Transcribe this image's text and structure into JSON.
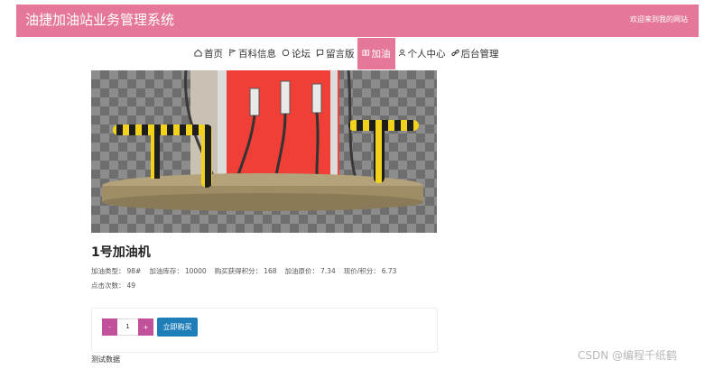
{
  "header": {
    "site_title": "油捷加油站业务管理系统",
    "welcome_text": "欢迎来到我的网站",
    "bg_color": "#e57898"
  },
  "nav": {
    "items": [
      {
        "label": "首页",
        "icon": "home-icon",
        "active": false
      },
      {
        "label": "百科信息",
        "icon": "flag-icon",
        "active": false
      },
      {
        "label": "论坛",
        "icon": "chat-circle-icon",
        "active": false
      },
      {
        "label": "留言版",
        "icon": "comment-icon",
        "active": false
      },
      {
        "label": "加油",
        "icon": "fuel-icon",
        "active": true
      },
      {
        "label": "个人中心",
        "icon": "user-icon",
        "active": false
      },
      {
        "label": "后台管理",
        "icon": "link-icon",
        "active": false
      }
    ]
  },
  "product": {
    "title": "1号加油机",
    "image_alt": "gas station fuel dispenser",
    "fields": [
      {
        "label": "加油类型：",
        "value": "98#"
      },
      {
        "label": "加油库存：",
        "value": "10000"
      },
      {
        "label": "购买获得积分：",
        "value": "168"
      },
      {
        "label": "加油原价：",
        "value": "7.34"
      },
      {
        "label": "现价/积分：",
        "value": "6.73"
      }
    ],
    "clicks": {
      "label": "点击次数：",
      "value": "49"
    }
  },
  "purchase": {
    "minus_label": "-",
    "plus_label": "+",
    "quantity": "1",
    "buy_label": "立即购买",
    "minus_color": "#c0519a",
    "buy_color": "#1f7db8"
  },
  "description": "测试数据",
  "watermark": "CSDN @编程千纸鹤"
}
